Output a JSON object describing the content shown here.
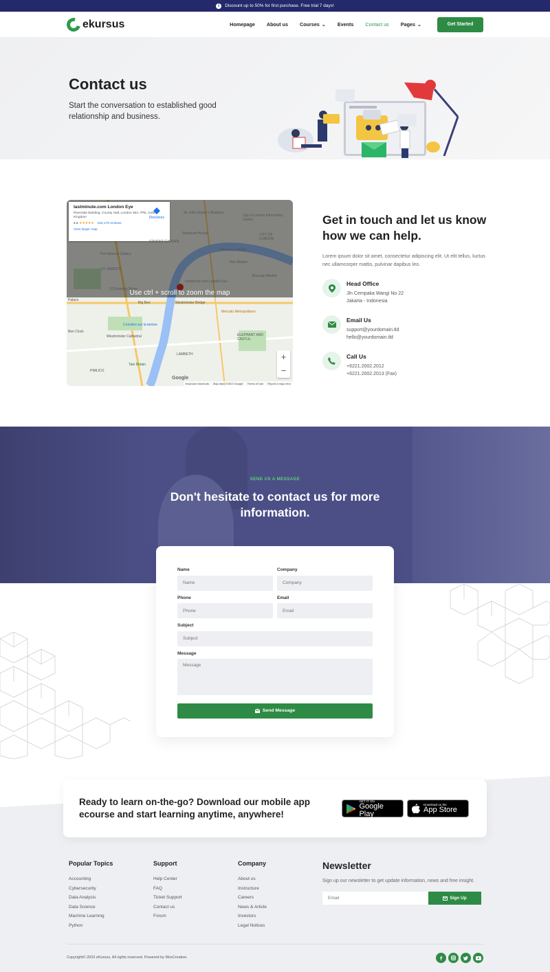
{
  "topbar": {
    "icon": "info-icon",
    "icon_glyph": "i",
    "text": "Discount up to 50% for first purchase. Free trial 7 days!"
  },
  "nav": {
    "logo": "ekursus",
    "items": [
      {
        "label": "Homepage"
      },
      {
        "label": "About us"
      },
      {
        "label": "Courses",
        "chevron": "⌄"
      },
      {
        "label": "Events"
      },
      {
        "label": "Contact us",
        "active": true
      },
      {
        "label": "Pages",
        "chevron": "⌄"
      }
    ],
    "cta": "Get Started"
  },
  "hero": {
    "title": "Contact us",
    "subtitle": "Start the conversation to established good relationship and business."
  },
  "map": {
    "place": "lastminute.com London Eye",
    "address": "Riverside Building, County Hall, London SE1 7PB, United Kingdom",
    "rating": "4.5",
    "stars": "★★★★★",
    "reviews": "152,176 reviews",
    "directions": "Directions",
    "larger": "View larger map",
    "overlay": "Use ctrl + scroll to zoom the map",
    "zoom_in": "+",
    "zoom_out": "−",
    "google": "Google",
    "footer": [
      "Keyboard shortcuts",
      "Map data ©2023 Google",
      "Terms of Use",
      "Report a map error"
    ],
    "labels": [
      "lastminute.com London Eye",
      "The National Gallery",
      "ST JAMES'S",
      "Big Ben",
      "Westminster Bridge",
      "Mercato Metropolitano",
      "ELEPHANT AND CASTLE",
      "Westminster Cathedral",
      "Croisière sur la tamise",
      "Tate Britain",
      "LAMBETH",
      "PIMLICO",
      "Tate Modern",
      "Borough Market",
      "Somerset House",
      "COVENT GARDEN",
      "CITY OF LONDON",
      "Sir John Soane's Museum",
      "City of London Information Centre",
      "Millennium Bridge",
      "Ben Clock",
      "10 Downing Street",
      "Palace"
    ]
  },
  "contact": {
    "title": "Get in touch and let us know how we can help.",
    "lead": "Lorem ipsum dolor sit amet, consectetur adipiscing elit. Ut elit tellus, luctus nec ullamcorper mattis, pulvinar dapibus leo.",
    "items": [
      {
        "icon": "location-pin-icon",
        "title": "Head Office",
        "lines": [
          "Jln Cempaka Wangi No 22",
          "Jakarta - Indonesia"
        ]
      },
      {
        "icon": "mail-icon",
        "title": "Email Us",
        "lines": [
          "support@yourdomain.tld",
          "hello@yourdomain.tld"
        ]
      },
      {
        "icon": "phone-icon",
        "title": "Call Us",
        "lines": [
          "+6221.2002.2012",
          "+6221.2002.2013 (Fax)"
        ]
      }
    ]
  },
  "message": {
    "label": "SEND US A MESSAGE",
    "title": "Don't hesitate to contact us for more information."
  },
  "form": {
    "name_label": "Name",
    "name_placeholder": "Name",
    "company_label": "Company",
    "company_placeholder": "Company",
    "phone_label": "Phone",
    "phone_placeholder": "Phone",
    "email_label": "Email",
    "email_placeholder": "Email",
    "subject_label": "Subject",
    "subject_placeholder": "Subject",
    "message_label": "Message",
    "message_placeholder": "Message",
    "submit": "Send Message"
  },
  "app": {
    "title": "Ready to learn on-the-go? Download our mobile app ecourse and start learning anytime, anywhere!",
    "google_small": "GET IT ON",
    "google_big": "Google Play",
    "apple_small": "Download on the",
    "apple_big": "App Store"
  },
  "footer": {
    "columns": [
      {
        "title": "Popular Topics",
        "links": [
          "Accounting",
          "Cybersecurity",
          "Data Analysis",
          "Data Science",
          "Machine Learning",
          "Python"
        ]
      },
      {
        "title": "Support",
        "links": [
          "Help Center",
          "FAQ",
          "Ticket Support",
          "Contact us",
          "Forum"
        ]
      },
      {
        "title": "Company",
        "links": [
          "About us",
          "Instructure",
          "Careers",
          "News & Article",
          "Investors",
          "Legal Notices"
        ]
      }
    ],
    "newsletter": {
      "title": "Newsletter",
      "text": "Sign up our newsletter to get update information, news and free insight.",
      "placeholder": "Email",
      "button": "Sign Up"
    },
    "copyright": "Copyright© 2023 eKursus, All rights reserved. Powered by MoxCreative.",
    "social": [
      "facebook-icon",
      "instagram-icon",
      "twitter-icon",
      "youtube-icon"
    ]
  },
  "colors": {
    "brand": "#2e8b45",
    "topbar": "#23296b",
    "band": "#4c4f86",
    "accent_text": "#5fd37a"
  }
}
